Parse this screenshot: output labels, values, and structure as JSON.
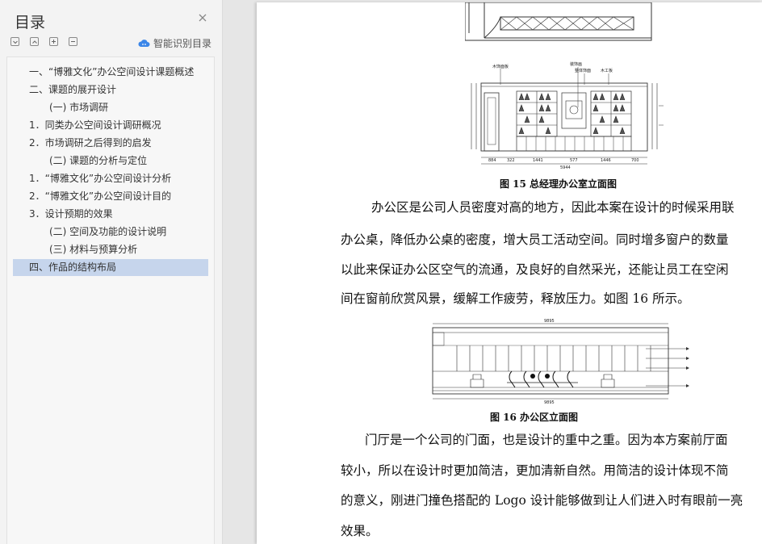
{
  "sidebar": {
    "title": "目录",
    "close_icon": "close-icon",
    "toolbar": [
      "collapse-all-icon",
      "expand-all-icon",
      "add-heading-icon",
      "remove-heading-icon"
    ],
    "smart_label": "智能识别目录",
    "smart_icon": "cloud-ai-icon",
    "selected_color": "#c6d5ec",
    "items": [
      {
        "label": "一、“博雅文化”办公空间设计课题概述",
        "indent": 0
      },
      {
        "label": "二、课题的展开设计",
        "indent": 0
      },
      {
        "label": "(一) 市场调研",
        "indent": 1
      },
      {
        "label": "1．同类办公空间设计调研概况",
        "indent": 0
      },
      {
        "label": "2．市场调研之后得到的启发",
        "indent": 0
      },
      {
        "label": "(二) 课题的分析与定位",
        "indent": 1
      },
      {
        "label": "1．“博雅文化”办公空间设计分析",
        "indent": 0
      },
      {
        "label": "2．“博雅文化”办公空间设计目的",
        "indent": 0
      },
      {
        "label": "3．设计预期的效果",
        "indent": 0
      },
      {
        "label": "(二) 空间及功能的设计说明",
        "indent": 1
      },
      {
        "label": "(三) 材料与预算分析",
        "indent": 1
      },
      {
        "label": "四、作品的结构布局",
        "indent": 0,
        "selected": true
      }
    ]
  },
  "document": {
    "figure15": {
      "caption": "图 15 总经理办公室立面图",
      "labels": [
        "木饰面板",
        "装饰画",
        "整体饰面",
        "木工板"
      ],
      "dims_bottom": [
        "884",
        "322",
        "1441",
        "577",
        "1446",
        "700"
      ],
      "dims_total": "5944"
    },
    "para1": [
      "办公区是公司人员密度对高的地方，因此本案在设计的时候采用联",
      "办公桌，降低办公桌的密度，增大员工活动空间。同时增多窗户的数量",
      "以此来保证办公区空气的流通，及良好的自然采光，还能让员工在空闲",
      "间在窗前欣赏风景，缓解工作疲劳，释放压力。如图 16 所示。"
    ],
    "figure16": {
      "caption": "图 16 办公区立面图",
      "dim": "9895"
    },
    "para2": [
      "门厅是一个公司的门面，也是设计的重中之重。因为本方案前厅面",
      "较小，所以在设计时更加简洁，更加清新自然。用简洁的设计体现不简",
      "的意义，刚进门撞色搭配的 Logo 设计能够做到让人们进入时有眼前一亮",
      "效果。"
    ]
  }
}
